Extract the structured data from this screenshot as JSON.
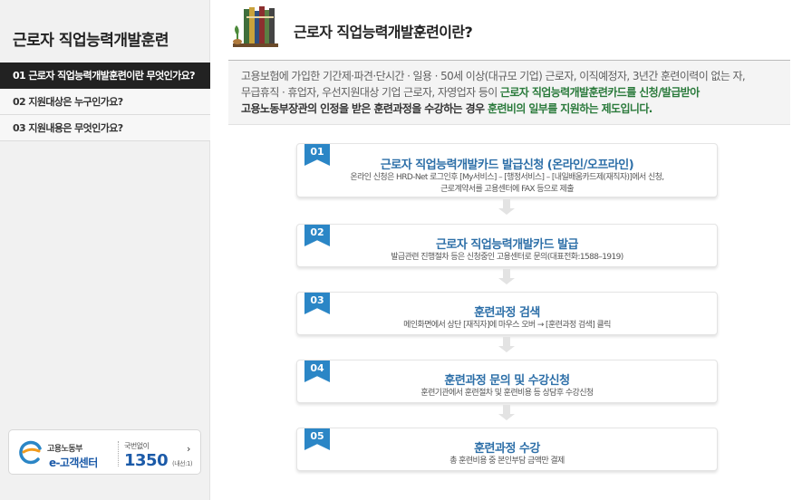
{
  "sidebar": {
    "title": "근로자 직업능력개발훈련",
    "items": [
      {
        "label": "01 근로자 직업능력개발훈련이란 무엇인가요?",
        "active": true
      },
      {
        "label": "02 지원대상은 누구인가요?",
        "active": false
      },
      {
        "label": "03 지원내용은 무엇인가요?",
        "active": false
      }
    ],
    "banner": {
      "org": "고용노동부",
      "center": "e-고객센터",
      "toll_free": "국번없이",
      "number": "1350",
      "ext": "(내선:1)"
    }
  },
  "page": {
    "title": "근로자 직업능력개발훈련이란?"
  },
  "intro": {
    "line1": "고용보험에 가입한 기간제·파견·단시간 · 일용 · 50세 이상(대규모 기업) 근로자, 이직예정자, 3년간 훈련이력이 없는 자,",
    "line2_a": "무급휴직 · 휴업자, 우선지원대상 기업 근로자, 자영업자 등이 ",
    "line2_b": "근로자 직업능력개발훈련카드를 신청/발급받아",
    "line3_a": "고용노동부장관의 인정을 받은 훈련과정을 수강하는 경우 ",
    "line3_b": "훈련비의 일부를 지원하는 제도입니다."
  },
  "steps": [
    {
      "num": "01",
      "title": "근로자 직업능력개발카드 발급신청 (온라인/오프라인)",
      "desc1": "온라인 신청은 HRD-Net 로그인후 [My서비스] – [행정서비스] – [내일배움카드제(재직자)]에서 신청,",
      "desc2": "근로계약서를 고용센터에 FAX 등으로 제출"
    },
    {
      "num": "02",
      "title": "근로자 직업능력개발카드 발급",
      "desc1": "발급관련 진행절차 등은 신청중인 고용센터로 문의(대표전화:1588–1919)",
      "desc2": ""
    },
    {
      "num": "03",
      "title": "훈련과정 검색",
      "desc1": "메인화면에서 상단 [재직자]에 마우스 오버 → [훈련과정 검색] 클릭",
      "desc2": ""
    },
    {
      "num": "04",
      "title": "훈련과정 문의 및 수강신청",
      "desc1": "훈련기관에서 훈련절차 및 훈련비용 등 상담후 수강신청",
      "desc2": ""
    },
    {
      "num": "05",
      "title": "훈련과정 수강",
      "desc1": "총 훈련비용 중 본인부담 금액만 결제",
      "desc2": ""
    }
  ],
  "colors": {
    "accent": "#2b86c6",
    "step_title": "#2d6fa8",
    "highlight_green": "#2a7a3b",
    "active_menu": "#222222"
  }
}
